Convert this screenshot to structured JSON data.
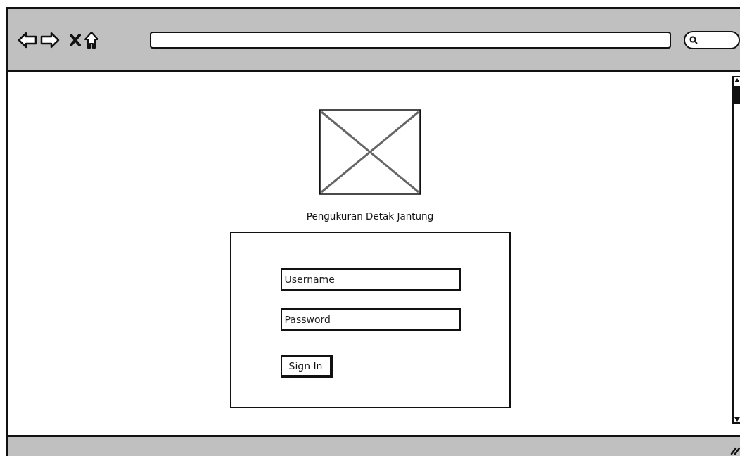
{
  "page_title": "Pengukuran Detak Jantung",
  "login_form": {
    "username": {
      "value": "Username"
    },
    "password": {
      "value": "Password"
    },
    "submit_button": "Sign In"
  }
}
